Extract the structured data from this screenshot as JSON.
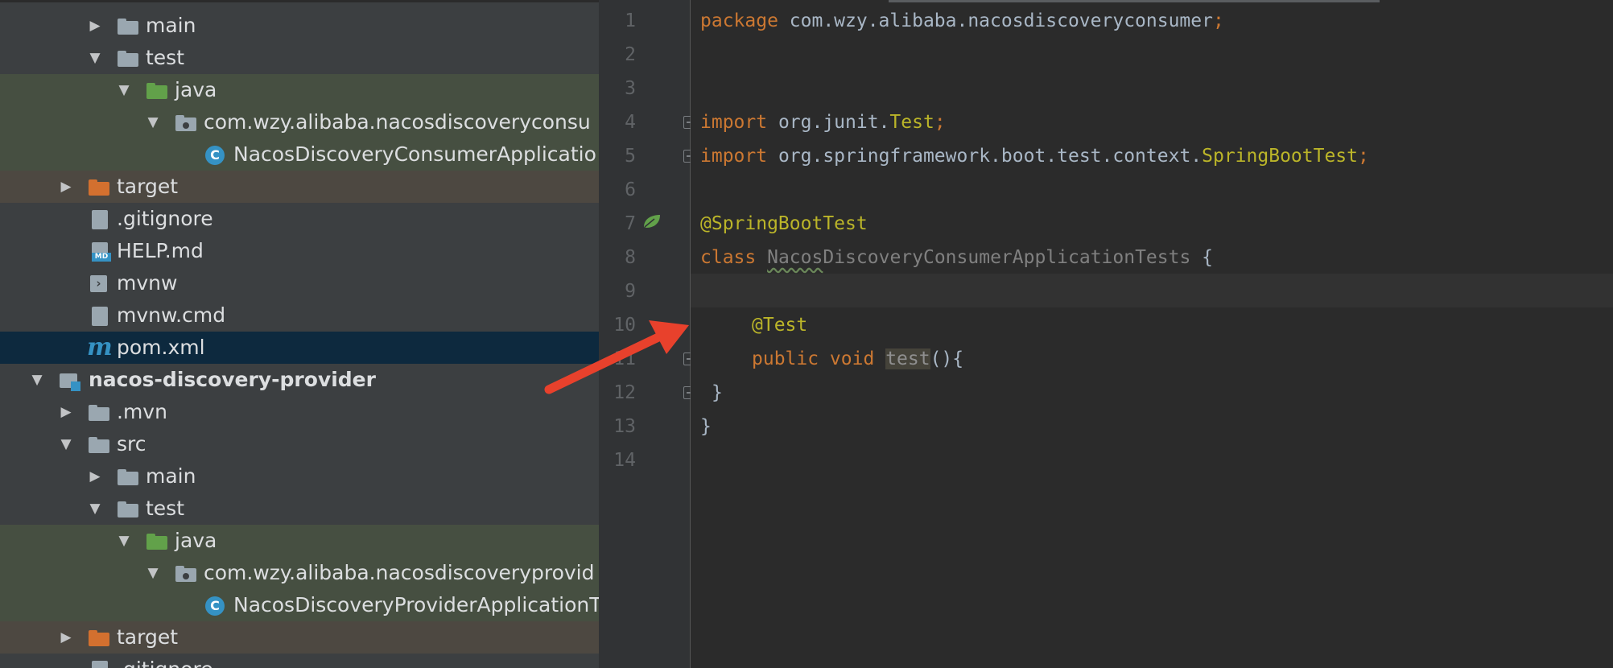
{
  "tree": {
    "rows": [
      {
        "label": "main"
      },
      {
        "label": "test"
      },
      {
        "label": "java"
      },
      {
        "label": "com.wzy.alibaba.nacosdiscoveryconsu"
      },
      {
        "label": "NacosDiscoveryConsumerApplicatio"
      },
      {
        "label": "target"
      },
      {
        "label": ".gitignore"
      },
      {
        "label": "HELP.md"
      },
      {
        "label": "mvnw"
      },
      {
        "label": "mvnw.cmd"
      },
      {
        "label": "pom.xml"
      },
      {
        "label": "nacos-discovery-provider"
      },
      {
        "label": ".mvn"
      },
      {
        "label": "src"
      },
      {
        "label": "main"
      },
      {
        "label": "test"
      },
      {
        "label": "java"
      },
      {
        "label": "com.wzy.alibaba.nacosdiscoveryprovid"
      },
      {
        "label": "NacosDiscoveryProviderApplicationT"
      },
      {
        "label": "target"
      },
      {
        "label": ".gitignore"
      }
    ],
    "md_badge": "MD",
    "pom_icon_letter": "m",
    "class_icon_letter": "C"
  },
  "gutter": {
    "line_numbers": [
      "1",
      "2",
      "3",
      "4",
      "5",
      "6",
      "7",
      "8",
      "9",
      "10",
      "11",
      "12",
      "13",
      "14"
    ]
  },
  "code": {
    "l1_kw": "package",
    "l1_rest": " com.wzy.alibaba.nacosdiscoveryconsumer",
    "l1_semi": ";",
    "l4_kw": "import",
    "l4_pkg": " org.junit.",
    "l4_cls": "Test",
    "l4_semi": ";",
    "l5_kw": "import",
    "l5_pkg": " org.springframework.boot.test.context.",
    "l5_cls": "SpringBootTest",
    "l5_semi": ";",
    "l7_ann": "@SpringBootTest",
    "l8_kw": "class",
    "l8_name_a": "Nacos",
    "l8_name_b": "DiscoveryConsumerApplicationTests",
    "l8_brace": " {",
    "l10_ann": "@Test",
    "l11_kw": "public void",
    "l11_method": "test",
    "l11_rest": "(){",
    "l12": "}",
    "l13": "}"
  },
  "colors": {
    "keyword": "#cc7832",
    "annotation": "#bbb529",
    "arrow": "#e8412c"
  }
}
